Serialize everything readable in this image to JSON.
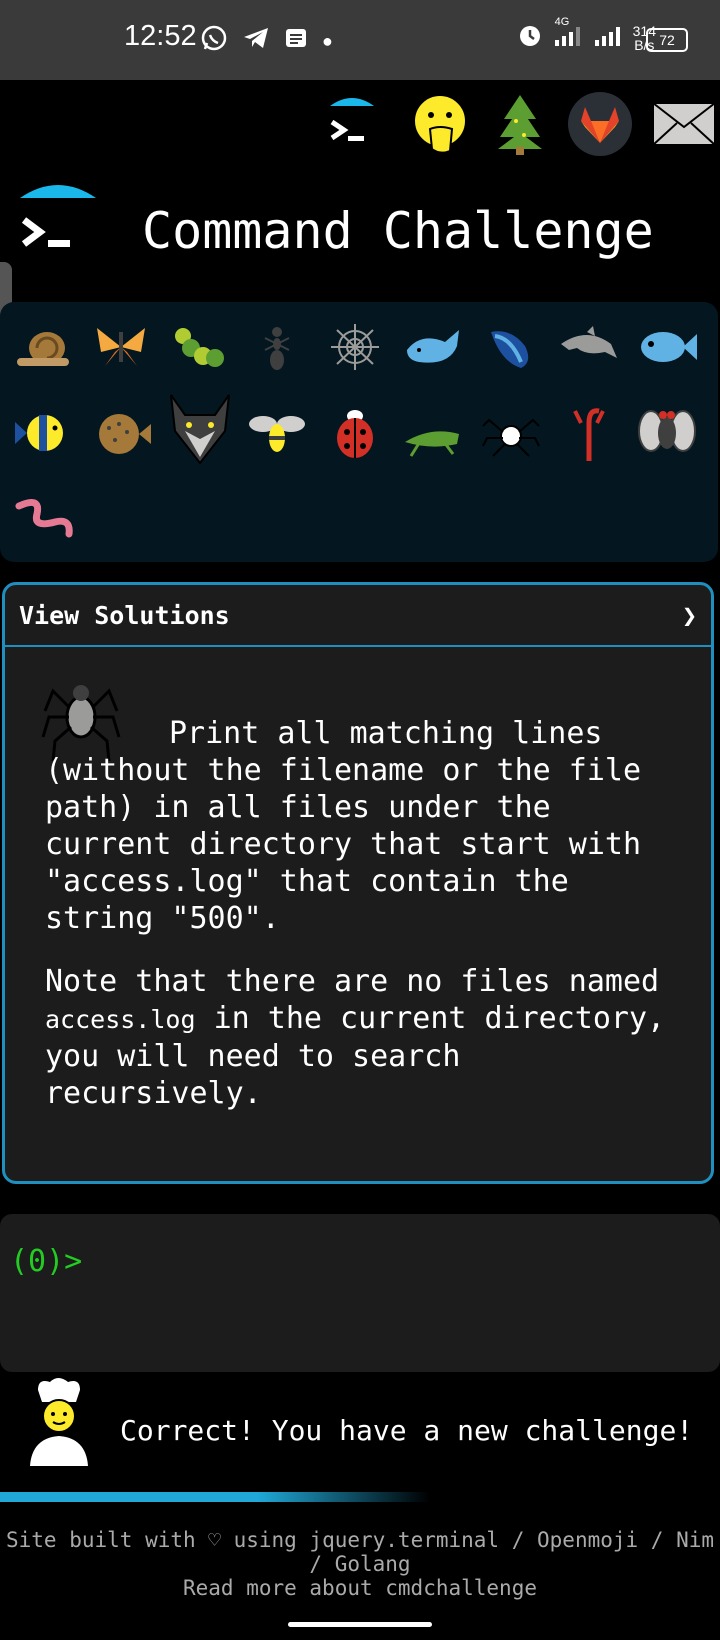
{
  "status_bar": {
    "time": "12:52",
    "network_type": "4G",
    "net_speed_value": "314",
    "net_speed_unit": "B/s",
    "battery_level": "72"
  },
  "top_nav": {
    "icons": [
      "terminal-icon",
      "face-hand-over-mouth-icon",
      "evergreen-tree-icon",
      "gitlab-icon",
      "envelope-icon"
    ]
  },
  "header": {
    "title": "Command Challenge"
  },
  "emoji_grid": {
    "items": [
      "snail",
      "butterfly",
      "caterpillar",
      "ant",
      "spider-web",
      "whale",
      "spouting-whale",
      "dolphin",
      "fish",
      "tropical-fish",
      "blowfish",
      "wolf",
      "bee",
      "ladybug",
      "cricket",
      "spider",
      "scorpion",
      "fly",
      "worm"
    ]
  },
  "solutions": {
    "label": "View Solutions",
    "chevron": "❯",
    "description": "Print all matching lines (without the filename or the file path) in all files under the current directory that start with \"access.log\" that contain the string \"500\".",
    "note_prefix": "Note that there are no files named ",
    "note_code": "access.log",
    "note_suffix": " in the current directory, you will need to search recursively."
  },
  "terminal": {
    "prompt": "(0)>"
  },
  "message": {
    "text": "Correct! You have a new challenge!"
  },
  "footer": {
    "line1": "Site built with ♡ using jquery.terminal / Openmoji / Nim / Golang",
    "line2": "Read more about cmdchallenge"
  },
  "colors": {
    "accent": "#1f8fbf",
    "prompt_green": "#22cc22",
    "panel_bg": "#04161f"
  }
}
